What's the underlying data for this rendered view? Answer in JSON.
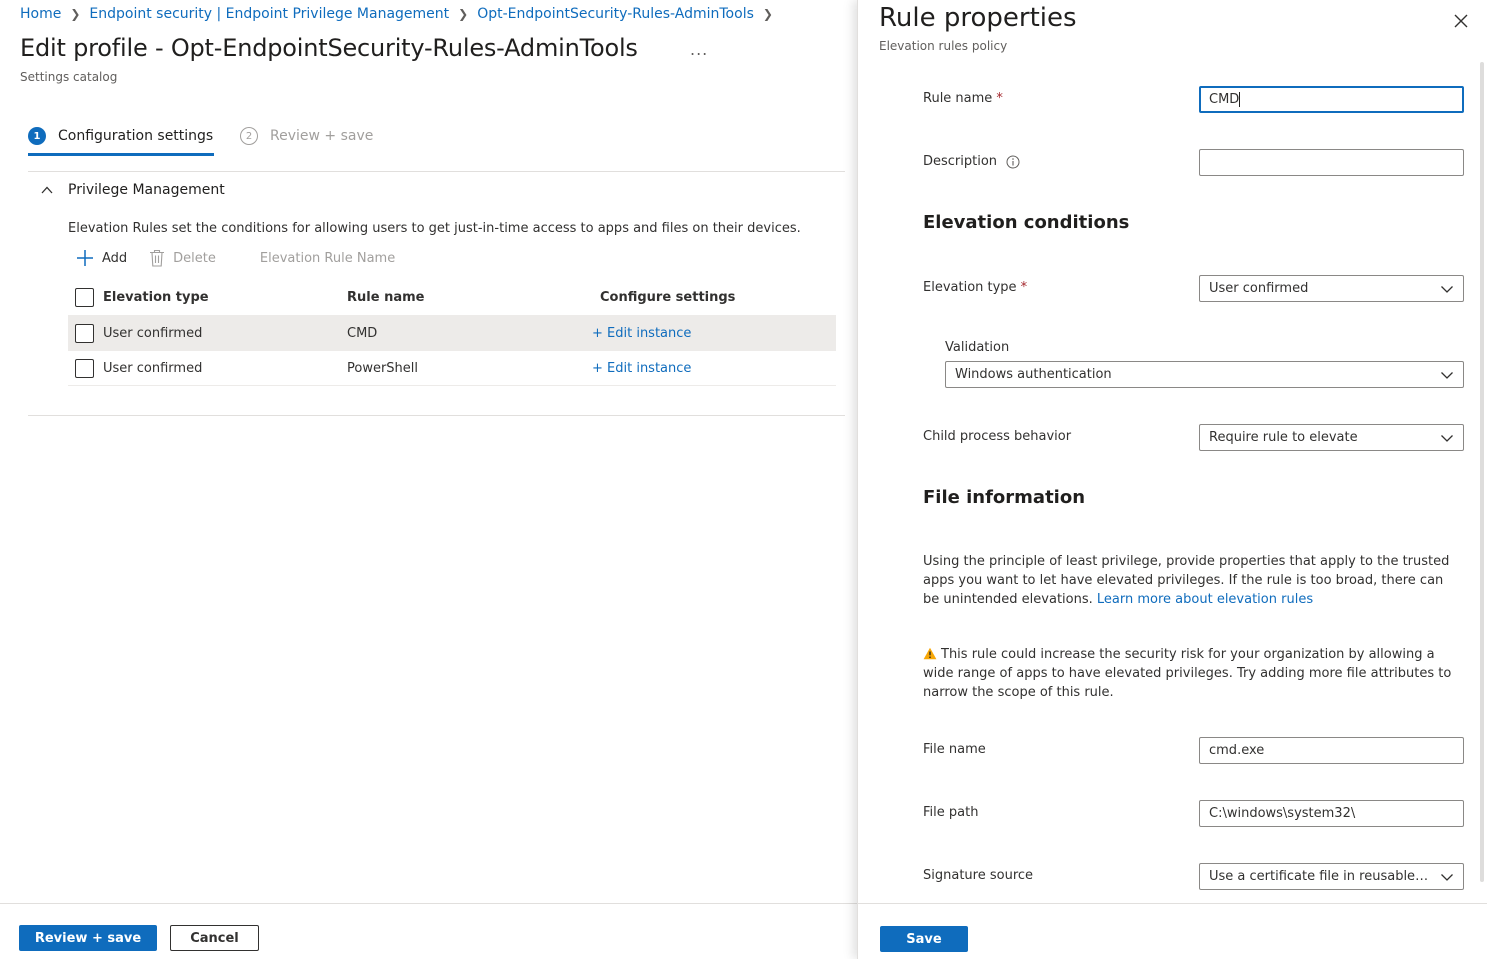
{
  "breadcrumb": {
    "items": [
      "Home",
      "Endpoint security | Endpoint Privilege Management",
      "Opt-EndpointSecurity-Rules-AdminTools"
    ]
  },
  "header": {
    "title": "Edit profile - Opt-EndpointSecurity-Rules-AdminTools",
    "more": "...",
    "subtitle": "Settings catalog"
  },
  "steps": [
    {
      "number": "1",
      "label": "Configuration settings"
    },
    {
      "number": "2",
      "label": "Review + save"
    }
  ],
  "section": {
    "title": "Privilege Management",
    "description": "Elevation Rules set the conditions for allowing users to get just-in-time access to apps and files on their devices."
  },
  "toolbar": {
    "add_label": "Add",
    "delete_label": "Delete",
    "search_placeholder": "Elevation Rule Name"
  },
  "table": {
    "columns": [
      "Elevation type",
      "Rule name",
      "Configure settings"
    ],
    "rows": [
      {
        "elevation_type": "User confirmed",
        "rule_name": "CMD",
        "configure": "+ Edit instance"
      },
      {
        "elevation_type": "User confirmed",
        "rule_name": "PowerShell",
        "configure": "+ Edit instance"
      }
    ]
  },
  "footer": {
    "review_label": "Review + save",
    "cancel_label": "Cancel"
  },
  "panel": {
    "title": "Rule properties",
    "subtitle": "Elevation rules policy",
    "rule_name_label": "Rule name",
    "rule_name_value": "CMD",
    "required_mark": "*",
    "description_label": "Description",
    "description_value": "",
    "elevation_conditions_heading": "Elevation conditions",
    "elevation_type_label": "Elevation type",
    "elevation_type_value": "User confirmed",
    "validation_label": "Validation",
    "validation_value": "Windows authentication",
    "child_process_label": "Child process behavior",
    "child_process_value": "Require rule to elevate",
    "file_info_heading": "File information",
    "file_info_text": "Using the principle of least privilege, provide properties that apply to the trusted apps you want to let have elevated privileges. If the rule is too broad, there can be unintended elevations.",
    "learn_more_link": "Learn more about elevation rules",
    "warning_text": "This rule could increase the security risk for your organization by allowing a wide range of apps to have elevated privileges. Try adding more file attributes to narrow the scope of this rule.",
    "file_name_label": "File name",
    "file_name_value": "cmd.exe",
    "file_path_label": "File path",
    "file_path_value": "C:\\windows\\system32\\",
    "signature_source_label": "Signature source",
    "signature_source_value": "Use a certificate file in reusable s...",
    "save_label": "Save"
  },
  "colors": {
    "accent": "#0f6cbd",
    "required": "#a4262c",
    "warning": "#f7a707",
    "selected_row": "#edebe9"
  }
}
